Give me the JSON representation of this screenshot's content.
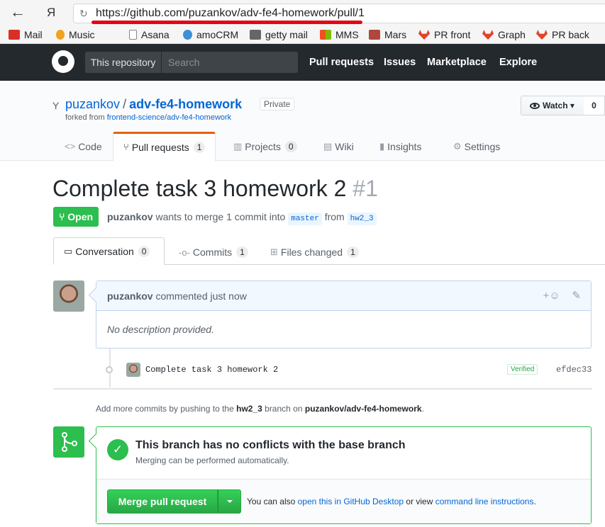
{
  "browser": {
    "back_glyph": "←",
    "yandex_glyph": "Я",
    "reload_glyph": "↻",
    "url": "https://github.com/puzankov/adv-fe4-homework/pull/1"
  },
  "bookmarks": [
    {
      "label": "Mail",
      "icon": "gmail-icon",
      "color": "#d93025"
    },
    {
      "label": "Music",
      "icon": "music-icon",
      "color": "#f0a31c"
    },
    {
      "label": "Asana",
      "icon": "page-icon",
      "color": "#888888"
    },
    {
      "label": "amoCRM",
      "icon": "amocrm-icon",
      "color": "#3d8fd8"
    },
    {
      "label": "getty mail",
      "icon": "getty-icon",
      "color": "#666666"
    },
    {
      "label": "MMS",
      "icon": "windows-icon",
      "color": "#7fba00"
    },
    {
      "label": "Mars",
      "icon": "mars-icon",
      "color": "#b0463c"
    },
    {
      "label": "PR front",
      "icon": "gitlab-icon",
      "color": "#e24329"
    },
    {
      "label": "Graph",
      "icon": "gitlab-icon",
      "color": "#e24329"
    },
    {
      "label": "PR back",
      "icon": "gitlab-icon",
      "color": "#e24329"
    }
  ],
  "gh_header": {
    "scope": "This repository",
    "search_placeholder": "Search",
    "nav": [
      "Pull requests",
      "Issues",
      "Marketplace",
      "Explore"
    ]
  },
  "repo": {
    "owner": "puzankov",
    "separator": "/",
    "name": "adv-fe4-homework",
    "visibility": "Private",
    "forked_prefix": "forked from",
    "forked_from": "frontend-science/adv-fe4-homework",
    "watch_label": "Watch",
    "watch_count": "0",
    "tabs": {
      "code": "Code",
      "pulls": "Pull requests",
      "pulls_count": "1",
      "projects": "Projects",
      "projects_count": "0",
      "wiki": "Wiki",
      "insights": "Insights",
      "settings": "Settings"
    }
  },
  "pr": {
    "title": "Complete task 3 homework 2",
    "number": "#1",
    "state": "Open",
    "author": "puzankov",
    "meta_mid": "wants to merge 1 commit into",
    "base": "master",
    "meta_from": "from",
    "head": "hw2_3",
    "tabs": {
      "conversation": "Conversation",
      "conversation_count": "0",
      "commits": "Commits",
      "commits_count": "1",
      "files": "Files changed",
      "files_count": "1"
    }
  },
  "comment": {
    "author": "puzankov",
    "action": "commented just now",
    "reaction_glyph": "+☺",
    "edit_glyph": "✎",
    "body": "No description provided."
  },
  "commit": {
    "message": "Complete task 3 homework 2",
    "verified": "Verified",
    "sha": "efdec33"
  },
  "push_note": {
    "prefix": "Add more commits by pushing to the",
    "branch": "hw2_3",
    "middle": "branch on",
    "repo": "puzankov/adv-fe4-homework",
    "suffix": "."
  },
  "merge": {
    "heading": "This branch has no conflicts with the base branch",
    "sub": "Merging can be performed automatically.",
    "button": "Merge pull request",
    "alt_prefix": "You can also",
    "alt_link1": "open this in GitHub Desktop",
    "alt_middle": "or view",
    "alt_link2": "command line instructions",
    "alt_suffix": "."
  },
  "colors": {
    "open_green": "#2cbe4e",
    "link_blue": "#0366d6",
    "header_dark": "#24292e",
    "tab_accent": "#e36209",
    "url_underline": "#e30613"
  }
}
